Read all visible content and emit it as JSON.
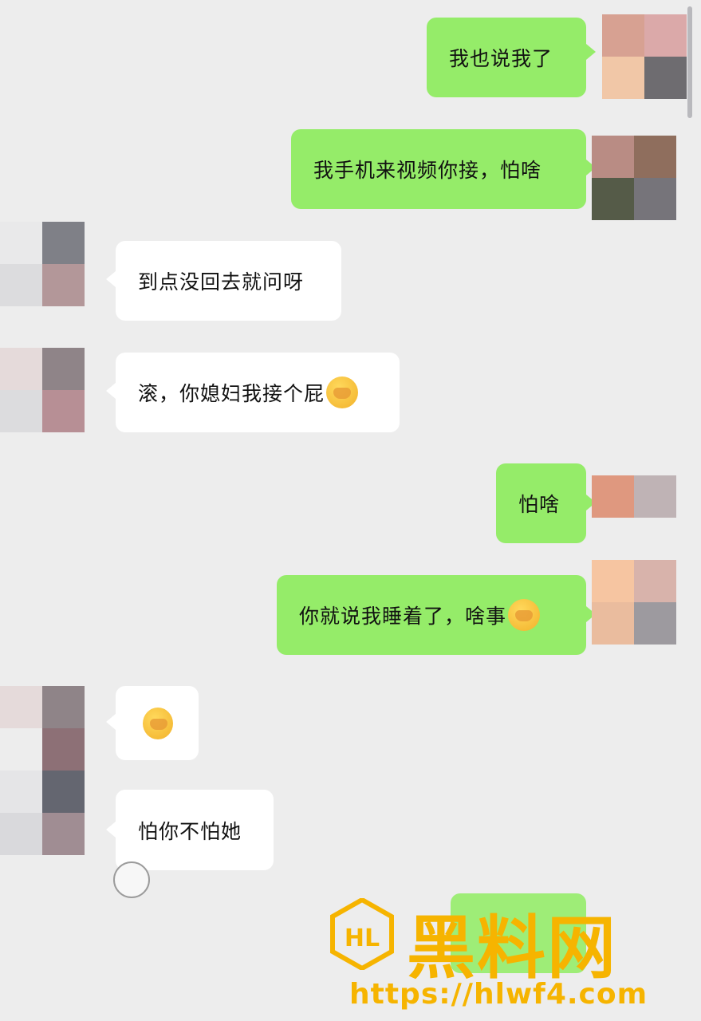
{
  "messages": [
    {
      "side": "mine",
      "text": "我也说我了"
    },
    {
      "side": "mine",
      "text": "我手机来视频你接，怕啥"
    },
    {
      "side": "theirs",
      "text": "到点没回去就问呀"
    },
    {
      "side": "theirs",
      "text": "滚，你媳妇我接个屁",
      "emoji": "facepalm-crying-emoji"
    },
    {
      "side": "mine",
      "text": "怕啥"
    },
    {
      "side": "mine",
      "text": "你就说我睡着了，啥事",
      "emoji": "hand-over-mouth-emoji"
    },
    {
      "side": "theirs",
      "text": "",
      "emoji": "facepalm-crying-emoji"
    },
    {
      "side": "theirs",
      "text": "怕你不怕她"
    }
  ],
  "watermark": {
    "brand": "黑料网",
    "logo": "HL",
    "url": "https://hlwf4.com"
  },
  "colors": {
    "background": "#ededed",
    "mine_bubble": "#95ec69",
    "theirs_bubble": "#ffffff",
    "watermark": "#f6b400"
  }
}
